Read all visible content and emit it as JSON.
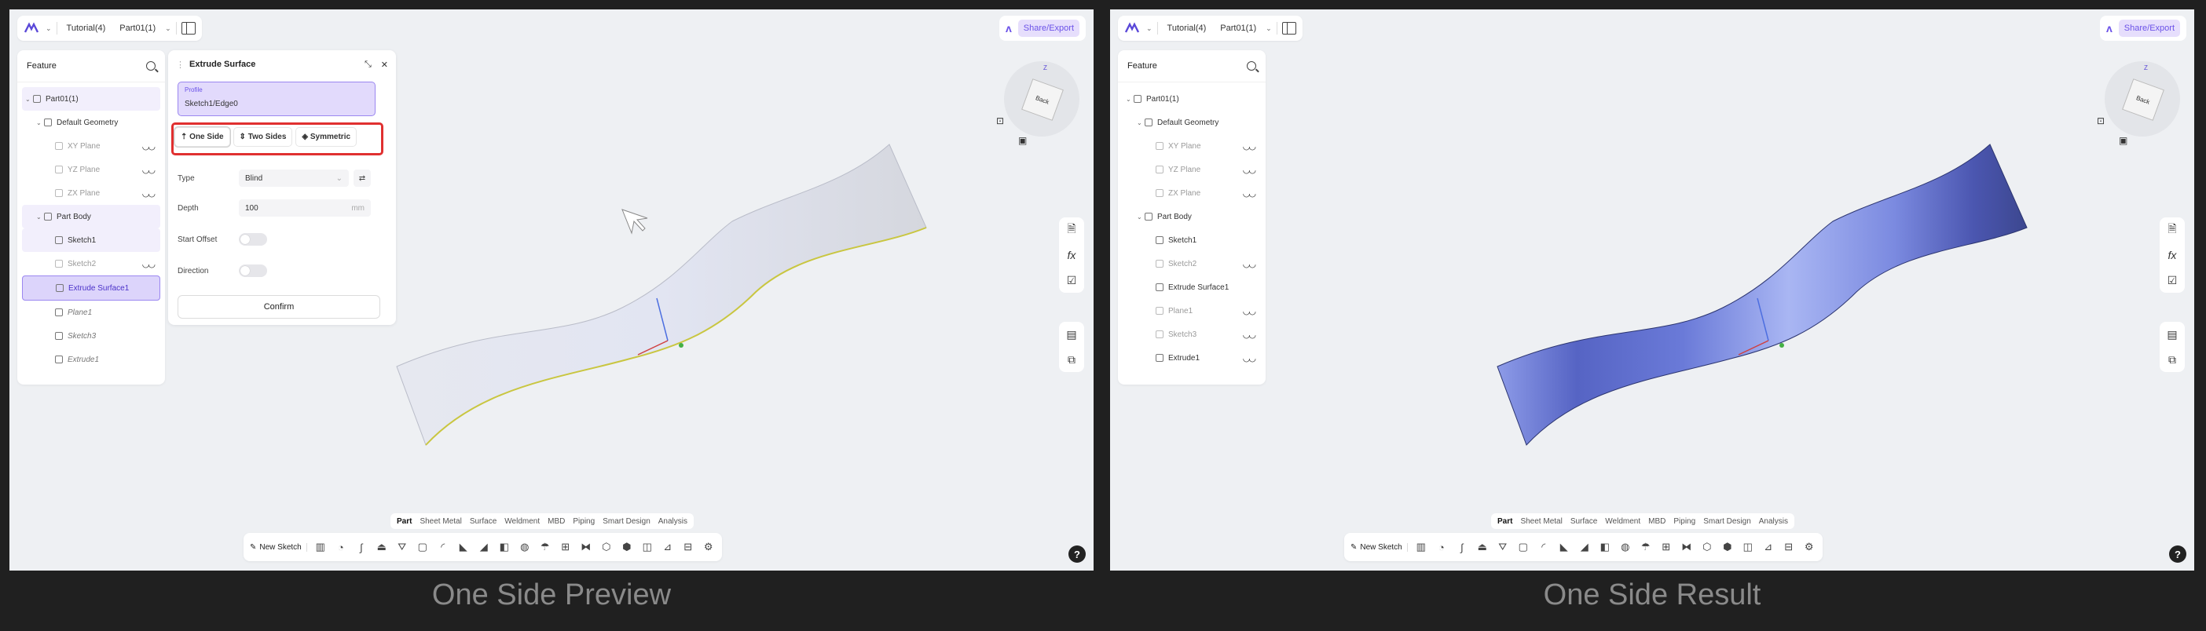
{
  "topbar": {
    "tutorial": "Tutorial(4)",
    "part": "Part01(1)",
    "share": "Share/Export"
  },
  "feature_panel": {
    "title": "Feature",
    "items": [
      {
        "label": "Part01(1)",
        "icon": "part-icon"
      },
      {
        "label": "Default Geometry",
        "icon": "geometry-icon"
      },
      {
        "label": "XY Plane",
        "icon": "plane-icon"
      },
      {
        "label": "YZ Plane",
        "icon": "plane-icon"
      },
      {
        "label": "ZX Plane",
        "icon": "plane-icon"
      },
      {
        "label": "Part Body",
        "icon": "body-icon"
      },
      {
        "label": "Sketch1",
        "icon": "sketch-icon"
      },
      {
        "label": "Sketch2",
        "icon": "sketch-icon"
      },
      {
        "label": "Extrude Surface1",
        "icon": "extrude-surface-icon"
      },
      {
        "label": "Plane1",
        "icon": "plane-icon"
      },
      {
        "label": "Sketch3",
        "icon": "sketch-icon"
      },
      {
        "label": "Extrude1",
        "icon": "extrude-icon"
      }
    ]
  },
  "dialog": {
    "title": "Extrude Surface",
    "profile_label": "Profile",
    "profile_value": "Sketch1/Edge0",
    "options": [
      "One Side",
      "Two Sides",
      "Symmetric"
    ],
    "selected_option": "One Side",
    "type_label": "Type",
    "type_value": "Blind",
    "depth_label": "Depth",
    "depth_value": "100",
    "depth_unit": "mm",
    "start_offset_label": "Start Offset",
    "direction_label": "Direction",
    "confirm": "Confirm"
  },
  "view_cube": {
    "face": "Back",
    "axis": "Z"
  },
  "tabs": [
    "Part",
    "Sheet Metal",
    "Surface",
    "Weldment",
    "MBD",
    "Piping",
    "Smart Design",
    "Analysis"
  ],
  "active_tab": "Part",
  "toolbar": {
    "new_sketch": "New Sketch"
  },
  "help": "?",
  "captions": {
    "left": "One Side Preview",
    "right": "One Side Result"
  },
  "colors": {
    "accent": "#6b52e8",
    "highlight_box": "#e03030",
    "preview_surface": "#dfe2ee",
    "result_surface": "#6a7ad8",
    "edge_selected": "#c9c640"
  }
}
